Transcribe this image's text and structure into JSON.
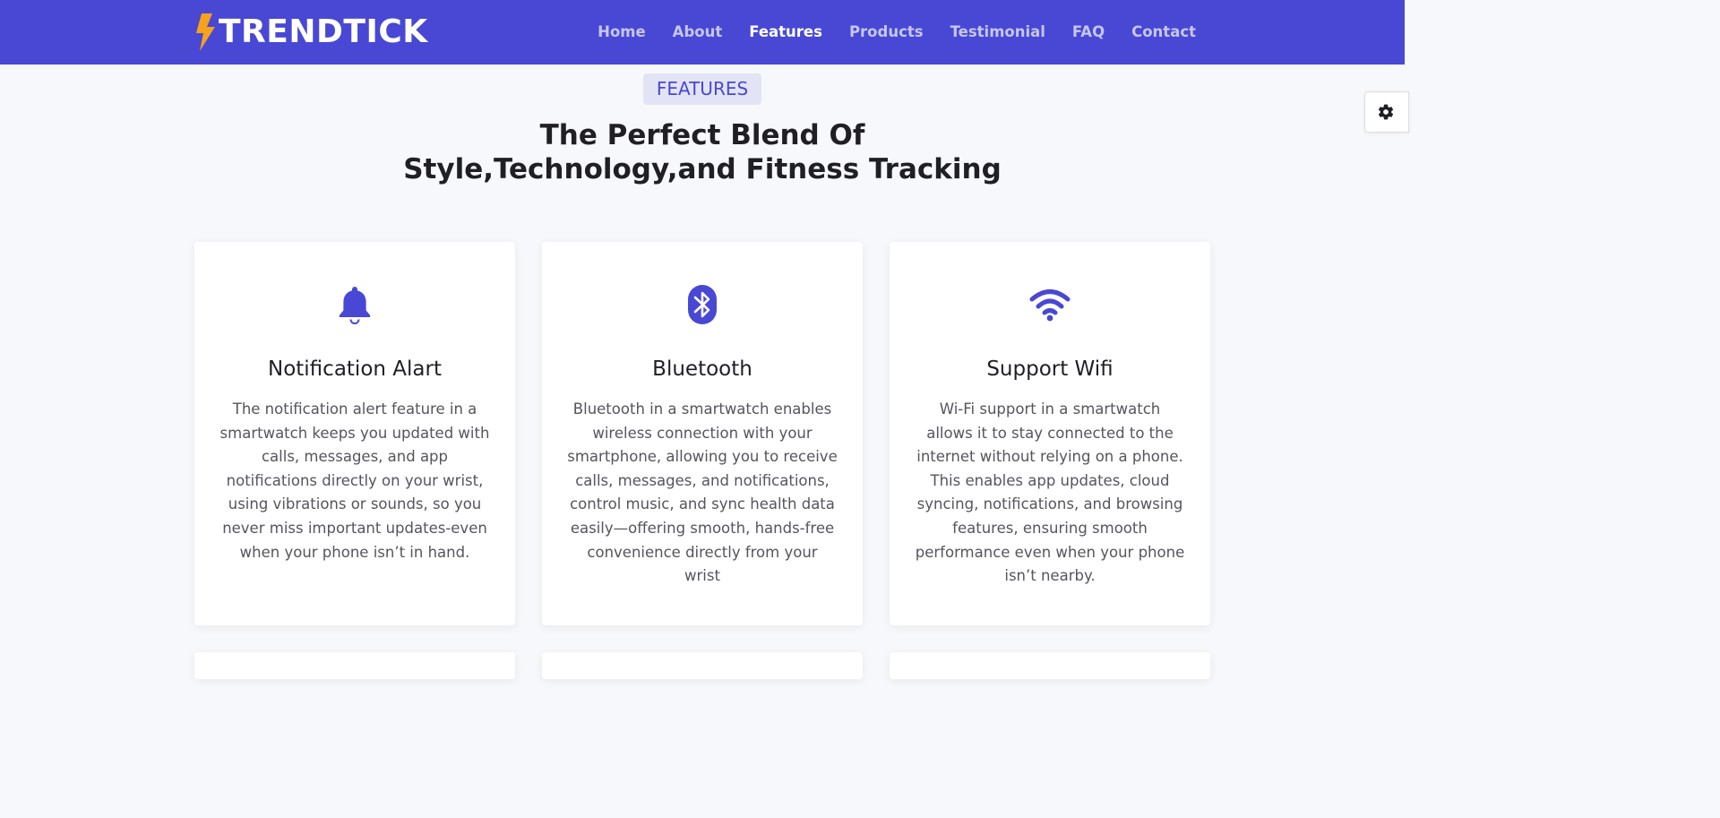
{
  "brand": {
    "name": "TRENDTICK",
    "icon": "lightning-bolt-icon",
    "accent": "#f5a21c"
  },
  "colors": {
    "primary": "#4848d4",
    "nav_inactive": "#c6c6ef",
    "background": "#f7f8fb"
  },
  "nav": {
    "items": [
      {
        "label": "Home",
        "active": false
      },
      {
        "label": "About",
        "active": false
      },
      {
        "label": "Features",
        "active": true
      },
      {
        "label": "Products",
        "active": false
      },
      {
        "label": "Testimonial",
        "active": false
      },
      {
        "label": "FAQ",
        "active": false
      },
      {
        "label": "Contact",
        "active": false
      }
    ]
  },
  "settings": {
    "icon": "gear-icon"
  },
  "features": {
    "badge": "FEATURES",
    "title_line1": "The Perfect Blend Of",
    "title_line2": "Style,Technology,and Fitness Tracking",
    "cards": [
      {
        "icon": "bell-icon",
        "title": "Notification Alart",
        "text": "The notification alert feature in a smartwatch keeps you updated with calls, messages, and app notifications directly on your wrist, using vibrations or sounds, so you never miss important updates-even when your phone isn’t in hand."
      },
      {
        "icon": "bluetooth-icon",
        "title": "Bluetooth",
        "text": "Bluetooth in a smartwatch enables wireless connection with your smartphone, allowing you to receive calls, messages, and notifications, control music, and sync health data easily—offering smooth, hands-free convenience directly from your wrist"
      },
      {
        "icon": "wifi-icon",
        "title": "Support Wifi",
        "text": "Wi-Fi support in a smartwatch allows it to stay connected to the internet without relying on a phone. This enables app updates, cloud syncing, notifications, and browsing features, ensuring smooth performance even when your phone isn’t nearby."
      }
    ]
  }
}
